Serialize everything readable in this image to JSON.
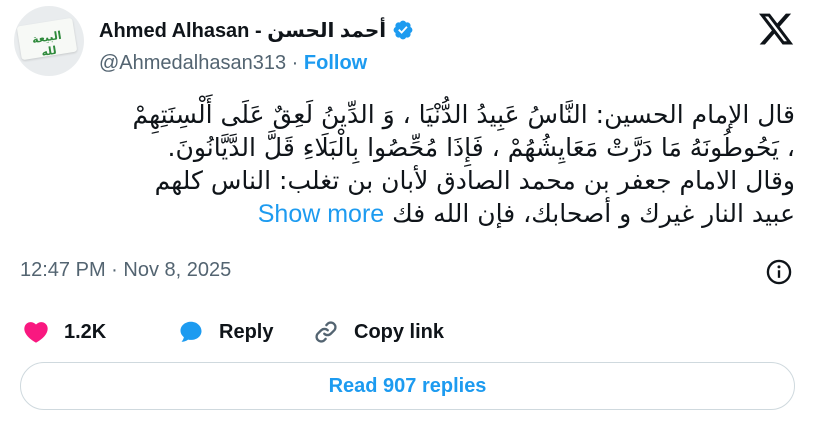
{
  "header": {
    "display_name": "Ahmed Alhasan - أحمد الحسن",
    "handle": "@Ahmedalhasan313",
    "separator": "·",
    "follow_label": "Follow"
  },
  "avatar": {
    "flag_text": "البيعة لله"
  },
  "tweet": {
    "lines": [
      "قال الإمام الحسين: النَّاسُ عَبِيدُ الدُّنْيَا ، وَ الدِّينُ لَعِقٌ عَلَى أَلْسِنَتِهِمْ",
      "، يَحُوطُونَهُ مَا دَرَّتْ مَعَايِشُهُمْ ، فَإِذَا مُحِّصُوا بِالْبَلَاءِ قَلَّ الدَّيَّانُونَ.",
      "وقال الامام جعفر بن محمد الصادق لأبان بن تغلب: الناس كلهم",
      "عبيد النار غيرك و أصحابك، فإن الله فك"
    ],
    "show_more_label": "Show more"
  },
  "meta": {
    "timestamp": "12:47 PM · Nov 8, 2025"
  },
  "actions": {
    "like_count": "1.2K",
    "reply_label": "Reply",
    "copy_link_label": "Copy link"
  },
  "read_replies_label": "Read 907 replies",
  "colors": {
    "accent": "#1d9bf0",
    "like": "#f91880",
    "muted": "#536471",
    "text": "#0f1419"
  },
  "icons": [
    "verified-badge-icon",
    "x-logo-icon",
    "info-icon",
    "heart-icon",
    "reply-bubble-icon",
    "link-icon"
  ]
}
